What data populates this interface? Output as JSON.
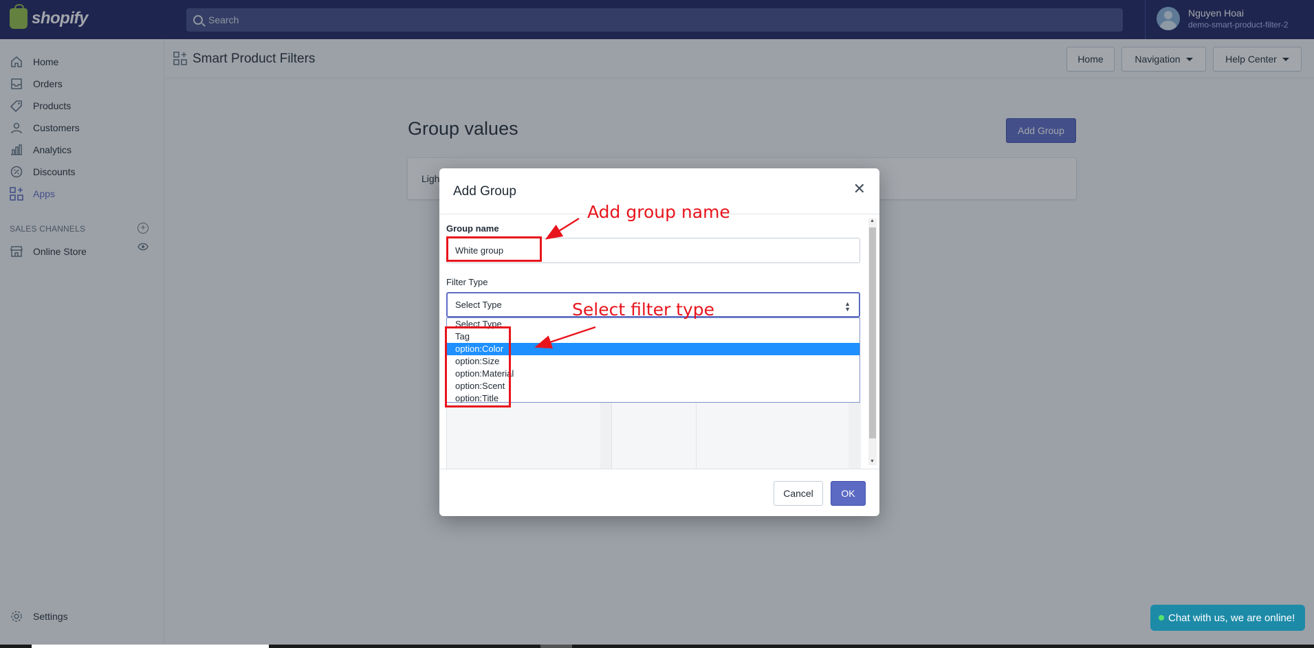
{
  "brand": {
    "name": "shopify"
  },
  "search": {
    "placeholder": "Search"
  },
  "user": {
    "name": "Nguyen Hoai",
    "store": "demo-smart-product-filter-2"
  },
  "sidebar": {
    "items": [
      {
        "label": "Home",
        "icon": "home-icon"
      },
      {
        "label": "Orders",
        "icon": "orders-icon"
      },
      {
        "label": "Products",
        "icon": "tag-icon"
      },
      {
        "label": "Customers",
        "icon": "person-icon"
      },
      {
        "label": "Analytics",
        "icon": "bar-chart-icon"
      },
      {
        "label": "Discounts",
        "icon": "discount-icon"
      },
      {
        "label": "Apps",
        "icon": "apps-icon",
        "active": true
      }
    ],
    "sales_channels_label": "SALES CHANNELS",
    "online_store": "Online Store",
    "settings": "Settings"
  },
  "app": {
    "title": "Smart Product Filters",
    "header_buttons": {
      "home": "Home",
      "navigation": "Navigation",
      "help": "Help Center"
    }
  },
  "page": {
    "title": "Group values",
    "add_group_button": "Add Group",
    "card_text": "Ligh"
  },
  "modal": {
    "title": "Add Group",
    "group_name_label": "Group name",
    "group_name_value": "White group",
    "filter_type_label": "Filter Type",
    "select_value": "Select Type",
    "options": [
      "Select Type",
      "Tag",
      "option:Color",
      "option:Size",
      "option:Material",
      "option:Scent",
      "option:Title"
    ],
    "highlighted_option": "option:Color",
    "cancel": "Cancel",
    "ok": "OK"
  },
  "annotations": {
    "group_name_note": "Add group name",
    "filter_type_note": "Select filter type",
    "color": "#e8141c"
  },
  "chat": {
    "label": "Chat with us, we are online!"
  },
  "colors": {
    "topbar": "#1c2260",
    "primary": "#5c6ac4",
    "highlight": "#1e90ff"
  }
}
